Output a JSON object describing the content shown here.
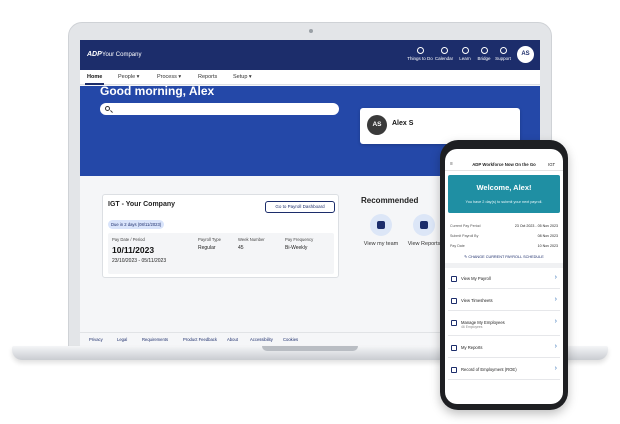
{
  "topbar": {
    "logo": "ADP",
    "company": "Your Company",
    "items": [
      {
        "label": "Things to Do",
        "icon": "checklist-icon"
      },
      {
        "label": "Calendar",
        "icon": "calendar-icon"
      },
      {
        "label": "Learn",
        "icon": "graduation-cap-icon"
      },
      {
        "label": "Bridge",
        "icon": "chat-icon"
      },
      {
        "label": "Support",
        "icon": "help-icon"
      }
    ],
    "avatar": "AS"
  },
  "nav": {
    "items": [
      {
        "label": "Home"
      },
      {
        "label": "People ▾"
      },
      {
        "label": "Process ▾"
      },
      {
        "label": "Reports"
      },
      {
        "label": "Setup ▾"
      }
    ]
  },
  "hero": {
    "greeting": "Good morning, Alex"
  },
  "user_card": {
    "initials": "AS",
    "name": "Alex S"
  },
  "payroll": {
    "title": "IGT - Your Company",
    "button": "Go to Payroll Dashboard",
    "due": "Due in 2 days (08/11/2023)",
    "pay_date_label": "Pay Date / Period",
    "pay_date": "10/11/2023",
    "period": "23/10/2023 - 05/11/2023",
    "pay_type_label": "Payroll Type",
    "pay_type": "Regular",
    "week_label": "Week Number",
    "week": "45",
    "freq_label": "Pay Frequency",
    "freq": "Bi-Weekly"
  },
  "recommended": {
    "title": "Recommended",
    "items": [
      {
        "label": "View my team",
        "icon": "team-icon"
      },
      {
        "label": "View Reports",
        "icon": "briefcase-icon"
      }
    ]
  },
  "footer": {
    "items": [
      "Privacy",
      "Legal",
      "Requirements",
      "Product Feedback",
      "About",
      "Accessibility",
      "Cookies"
    ]
  },
  "phone": {
    "header_title": "ADP Workforce Now On the Go",
    "header_left": "≡",
    "header_right": "IGT",
    "welcome": "Welcome, Alex!",
    "welcome_sub": "You have 2 day(s) to submit your next payroll.",
    "rows": [
      {
        "k": "Current Pay Period",
        "v": "23 Oct 2023 - 05 Nov 2023"
      },
      {
        "k": "Submit Payroll By",
        "v": "08 Nov 2023"
      },
      {
        "k": "Pay Date",
        "v": "10 Nov 2023"
      }
    ],
    "change_link": "✎ CHANGE CURRENT PAYROLL SCHEDULE",
    "menu": [
      {
        "label": "View My Payroll",
        "sub": "",
        "icon": "payroll-icon"
      },
      {
        "label": "View Timesheets",
        "sub": "",
        "icon": "timesheet-icon"
      },
      {
        "label": "Manage My Employees",
        "sub": "46 Employees",
        "icon": "employees-icon"
      },
      {
        "label": "My Reports",
        "sub": "",
        "icon": "reports-icon"
      },
      {
        "label": "Record of Employment (ROE)",
        "sub": "",
        "icon": "document-icon"
      }
    ]
  }
}
